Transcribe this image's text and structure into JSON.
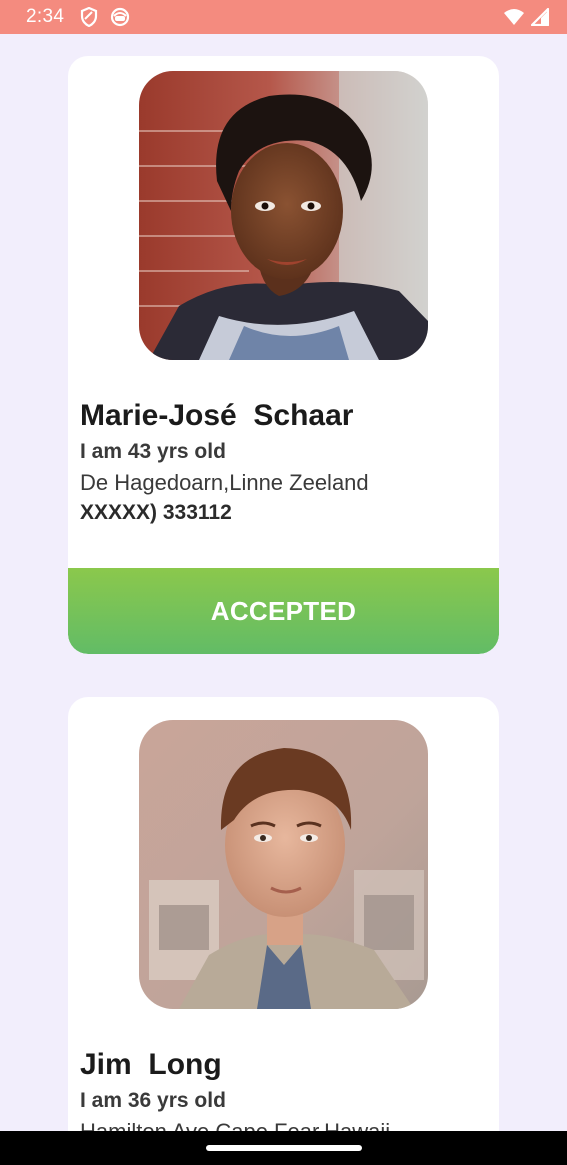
{
  "status_bar": {
    "time": "2:34",
    "icons_left": [
      "shield-icon",
      "cat-face-icon"
    ],
    "icons_right": [
      "wifi-icon",
      "cellular-signal-icon"
    ]
  },
  "cards": [
    {
      "name": "Marie-José  Schaar",
      "age": "I am 43 yrs old",
      "address": "De Hagedoarn,Linne Zeeland",
      "phone": "XXXXX) 333112",
      "status_label": "ACCEPTED",
      "photo": "woman-portrait"
    },
    {
      "name": "Jim  Long",
      "age": "I am 36 yrs old",
      "address": "Hamilton Ave,Cape Fear,Hawaii",
      "photo": "man-portrait"
    }
  ],
  "colors": {
    "status_bar": "#F48B7F",
    "background": "#F2EEFC",
    "accepted_gradient_top": "#8BC84C",
    "accepted_gradient_bottom": "#62BC66"
  }
}
